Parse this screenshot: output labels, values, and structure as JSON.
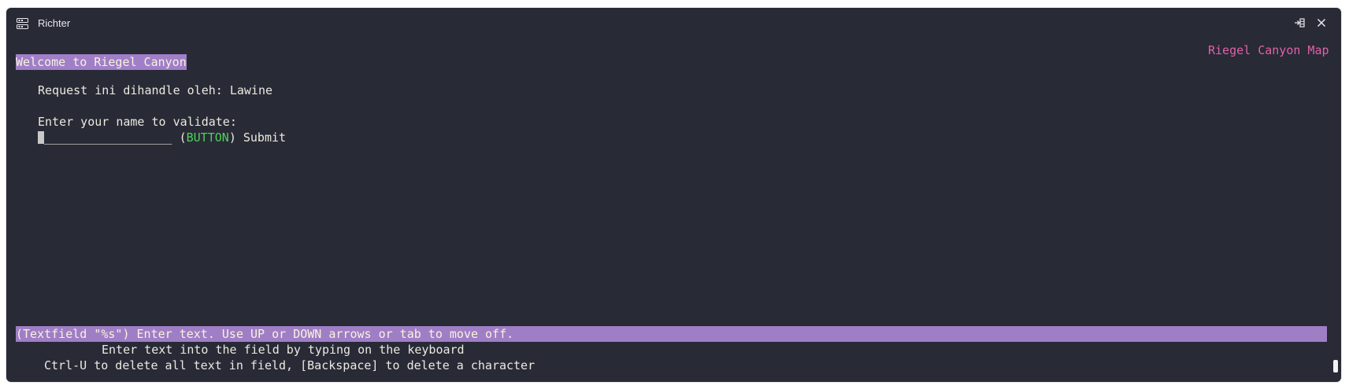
{
  "window": {
    "title": "Richter"
  },
  "titlebar_icons": {
    "app": "terminal-app-icon",
    "split": "split-pane-icon",
    "close": "close-icon"
  },
  "screen": {
    "map_title": "Riegel Canyon Map",
    "welcome": "Welcome to Riegel Canyon",
    "handled_by": "Request ini dihandle oleh: Lawine",
    "prompt": "Enter your name to validate:",
    "field_placeholder": "__________________",
    "button_open": " (",
    "button_keyword": "BUTTON",
    "button_close": ") ",
    "submit_label": "Submit"
  },
  "help": {
    "status_line": "(Textfield \"%s\") Enter text. Use UP or DOWN arrows or tab to move off.",
    "line1": "Enter text into the field by typing on the keyboard",
    "line2": "Ctrl-U to delete all text in field, [Backspace] to delete a character"
  },
  "colors": {
    "background": "#282a36",
    "highlight": "#a07fc8",
    "map_title": "#e062a6",
    "button_keyword": "#4fd15a",
    "text": "#ece9e1"
  }
}
